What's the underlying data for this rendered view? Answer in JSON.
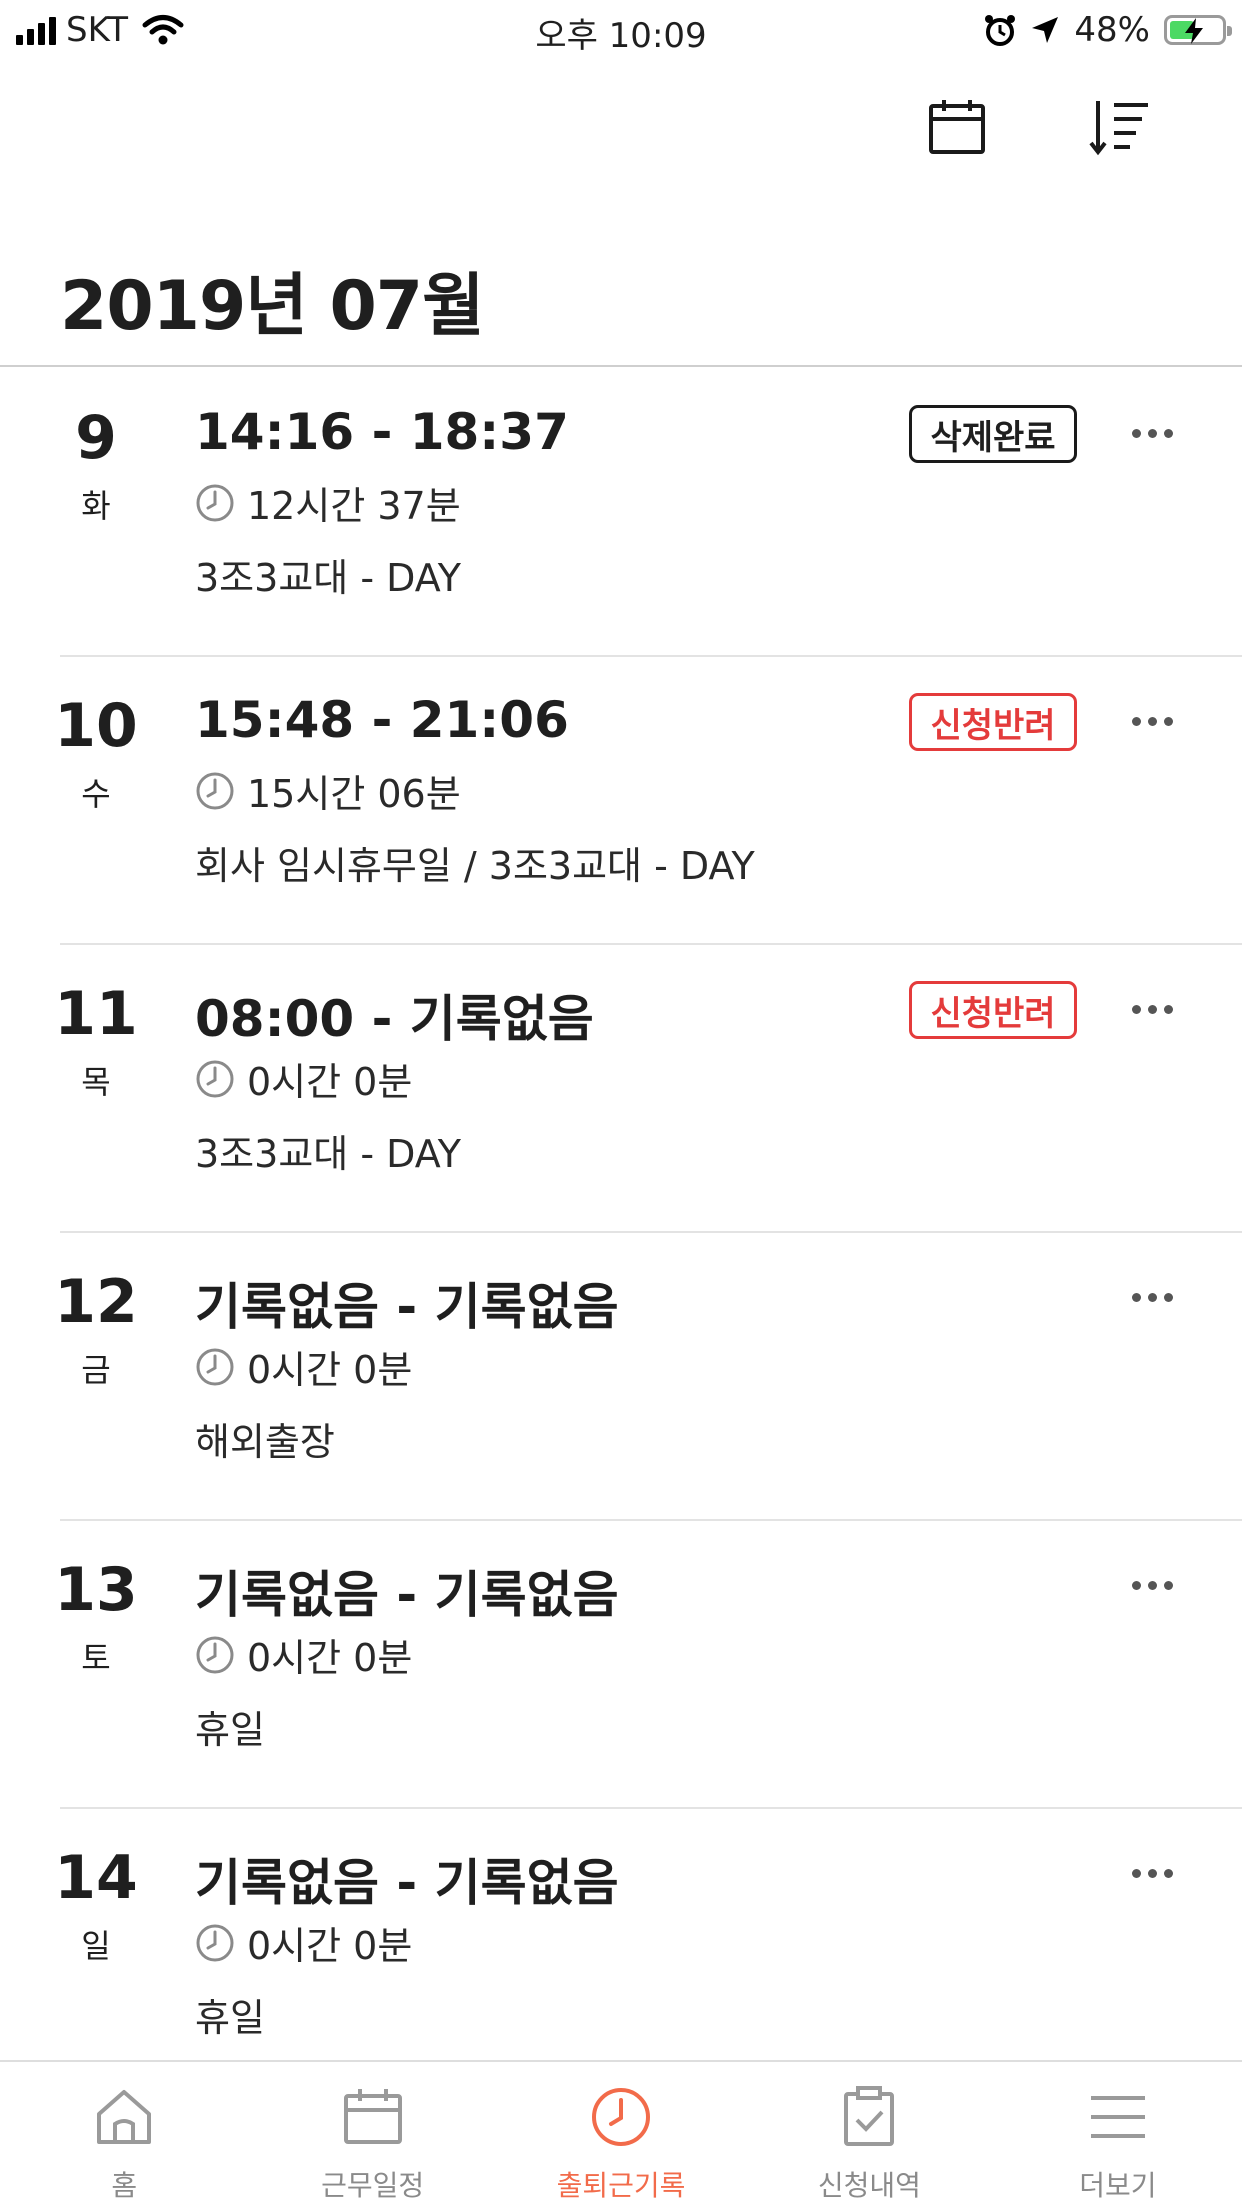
{
  "status_bar": {
    "carrier": "SKT",
    "time": "오후 10:09",
    "battery": "48%",
    "battery_level": 0.48
  },
  "header": {
    "title": "2019년 07월",
    "calendar_icon": "calendar-icon",
    "sort_icon": "sort-icon"
  },
  "records": [
    {
      "day": "9",
      "weekday": "화",
      "time": "14:16 - 18:37",
      "duration": "12시간 37분",
      "shift": "3조3교대 - DAY",
      "badge": "삭제완료",
      "badge_type": "done"
    },
    {
      "day": "10",
      "weekday": "수",
      "time": "15:48 - 21:06",
      "duration": "15시간 06분",
      "shift": "회사 임시휴무일 / 3조3교대 - DAY",
      "badge": "신청반려",
      "badge_type": "rejected"
    },
    {
      "day": "11",
      "weekday": "목",
      "time": "08:00 - 기록없음",
      "duration": "0시간 0분",
      "shift": "3조3교대 - DAY",
      "badge": "신청반려",
      "badge_type": "rejected"
    },
    {
      "day": "12",
      "weekday": "금",
      "time": "기록없음 - 기록없음",
      "duration": "0시간 0분",
      "shift": "해외출장",
      "badge": "",
      "badge_type": ""
    },
    {
      "day": "13",
      "weekday": "토",
      "time": "기록없음 - 기록없음",
      "duration": "0시간 0분",
      "shift": "휴일",
      "badge": "",
      "badge_type": ""
    },
    {
      "day": "14",
      "weekday": "일",
      "time": "기록없음 - 기록없음",
      "duration": "0시간 0분",
      "shift": "휴일",
      "badge": "",
      "badge_type": ""
    }
  ],
  "tabs": [
    {
      "label": "홈",
      "icon": "home-icon",
      "active": false
    },
    {
      "label": "근무일정",
      "icon": "calendar-icon",
      "active": false
    },
    {
      "label": "출퇴근기록",
      "icon": "clock-icon",
      "active": true
    },
    {
      "label": "신청내역",
      "icon": "clipboard-check-icon",
      "active": false
    },
    {
      "label": "더보기",
      "icon": "menu-icon",
      "active": false
    }
  ],
  "colors": {
    "accent": "#f26b4a",
    "rejected": "#e43b3b",
    "text": "#1f1f1f",
    "muted": "#8a8a8a"
  }
}
